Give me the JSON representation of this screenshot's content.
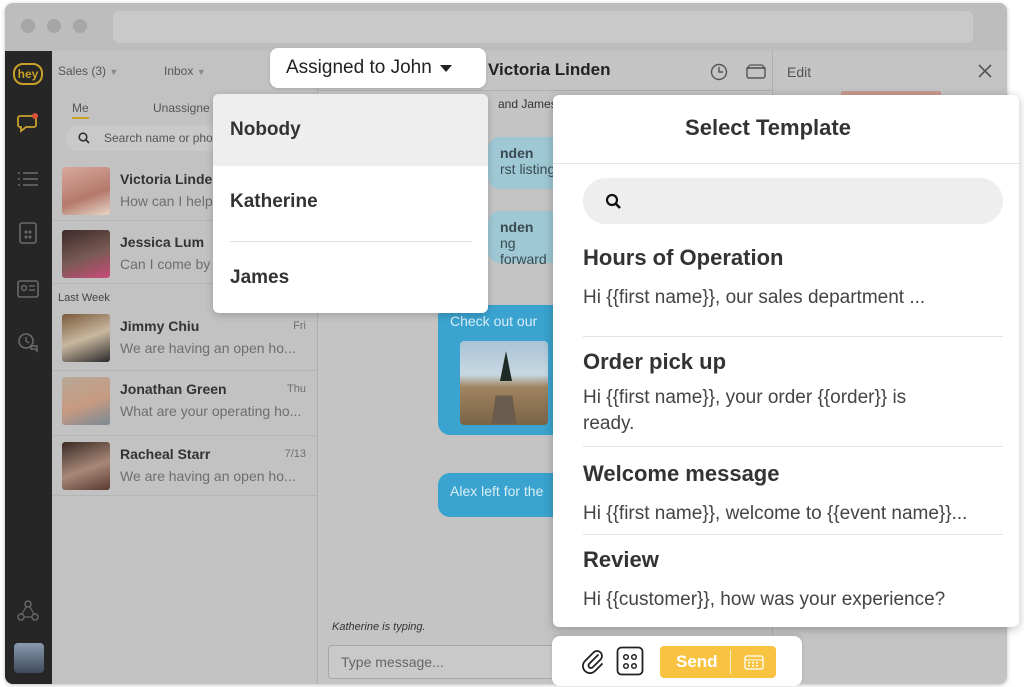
{
  "sidebar": {
    "logo_text": "hey",
    "icons": [
      "chat-icon",
      "list-icon",
      "template-icon",
      "contact-card-icon",
      "history-chat-icon",
      "team-icon"
    ]
  },
  "conversations": {
    "header": {
      "inbox_filter": "Sales (3)",
      "folder": "Inbox"
    },
    "tabs": {
      "me": "Me",
      "unassigned": "Unassigne"
    },
    "search_placeholder": "Search name or pho",
    "section_last_week": "Last Week",
    "items": [
      {
        "name": "Victoria Linde",
        "preview": "How can I help",
        "date": ""
      },
      {
        "name": "Jessica Lum",
        "preview": "Can I come by",
        "date": ""
      },
      {
        "name": "Jimmy Chiu",
        "preview": "We are having an open ho...",
        "date": "Fri"
      },
      {
        "name": "Jonathan Green",
        "preview": "What are your operating ho...",
        "date": "Thu"
      },
      {
        "name": "Racheal Starr",
        "preview": "We are having an open ho...",
        "date": "7/13"
      }
    ]
  },
  "chat": {
    "contact_name": "Victoria Linden",
    "participants": "and James",
    "bubbles": [
      "nden",
      "rst listing.",
      "nden",
      "ng forward",
      "Check out our",
      "Alex left for the"
    ],
    "typing": "Katherine is typing.",
    "input_placeholder": "Type message..."
  },
  "right_pane": {
    "edit_label": "Edit"
  },
  "assign": {
    "label": "Assigned to John",
    "options": [
      "Nobody",
      "Katherine",
      "James"
    ]
  },
  "template_modal": {
    "title": "Select Template",
    "templates": [
      {
        "name": "Hours of Operation",
        "body": "Hi {{first name}}, our sales department ..."
      },
      {
        "name": "Order pick up",
        "body": "Hi {{first name}}, your order {{order}} is ready."
      },
      {
        "name": "Welcome message",
        "body": "Hi {{first name}}, welcome to {{event name}}..."
      },
      {
        "name": "Review",
        "body": "Hi {{customer}}, how was your experience?"
      }
    ]
  },
  "composer": {
    "send_label": "Send"
  }
}
